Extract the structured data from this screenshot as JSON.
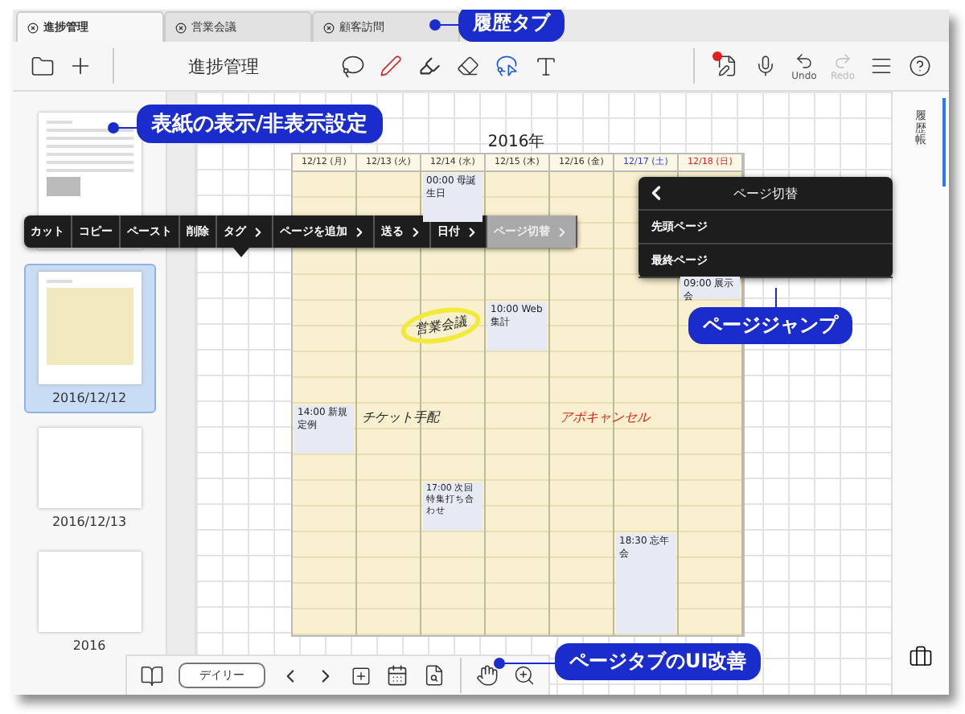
{
  "tabs": [
    {
      "label": "進捗管理",
      "selected": true
    },
    {
      "label": "営業会議",
      "selected": false
    },
    {
      "label": "顧客訪問",
      "selected": false
    }
  ],
  "toolbar": {
    "title": "進捗管理",
    "undo": {
      "label": "Undo",
      "disabled": false
    },
    "redo": {
      "label": "Redo",
      "disabled": true
    }
  },
  "thumbnails": [
    {
      "selected": false,
      "kind": "cover"
    },
    {
      "label": "2016/12/12",
      "selected": true,
      "kind": "calendar"
    },
    {
      "label": "2016/12/13",
      "selected": false,
      "kind": "blank"
    },
    {
      "label": "2016",
      "selected": false,
      "kind": "blank"
    }
  ],
  "calendar": {
    "title": "2016年",
    "days": [
      {
        "label": "12/12 (月)"
      },
      {
        "label": "12/13 (火)"
      },
      {
        "label": "12/14 (水)"
      },
      {
        "label": "12/15 (木)"
      },
      {
        "label": "12/16 (金)"
      },
      {
        "label": "12/17 (土)",
        "color": "#2a3ee0"
      },
      {
        "label": "12/18 (日)",
        "color": "#e02020"
      }
    ],
    "events": [
      {
        "text": "00:00 母誕生日"
      },
      {
        "text": "09:00 展示会"
      },
      {
        "text": "10:00 Web集計"
      },
      {
        "text": "14:00 新規定例"
      },
      {
        "text": "17:00 次回特集打ち合わせ"
      },
      {
        "text": "18:30 忘年会"
      }
    ],
    "notes": [
      {
        "text": "営業会議",
        "color": "#222222",
        "circled": true
      },
      {
        "text": "チケット手配",
        "color": "#222222",
        "circled": false
      },
      {
        "text": "アポキャンセル",
        "color": "#e02020",
        "circled": false
      }
    ]
  },
  "context_menu": [
    {
      "label": "カット",
      "submenu": false,
      "selected": false
    },
    {
      "label": "コピー",
      "submenu": false,
      "selected": false
    },
    {
      "label": "ペースト",
      "submenu": false,
      "selected": false
    },
    {
      "label": "削除",
      "submenu": false,
      "selected": false
    },
    {
      "label": "タグ",
      "submenu": true,
      "selected": false
    },
    {
      "label": "ページを追加",
      "submenu": true,
      "selected": false
    },
    {
      "label": "送る",
      "submenu": true,
      "selected": false
    },
    {
      "label": "日付",
      "submenu": true,
      "selected": false
    },
    {
      "label": "ページ切替",
      "submenu": true,
      "selected": true
    }
  ],
  "submenu": {
    "title": "ページ切替",
    "items": [
      "先頭ページ",
      "最終ページ"
    ]
  },
  "bottom_bar": {
    "view_button": "デイリー"
  },
  "right_panel": {
    "label": "履歴帳"
  },
  "callouts": [
    "履歴タブ",
    "表紙の表示/非表示設定",
    "ページジャンプ",
    "ページタブのUI改善"
  ]
}
